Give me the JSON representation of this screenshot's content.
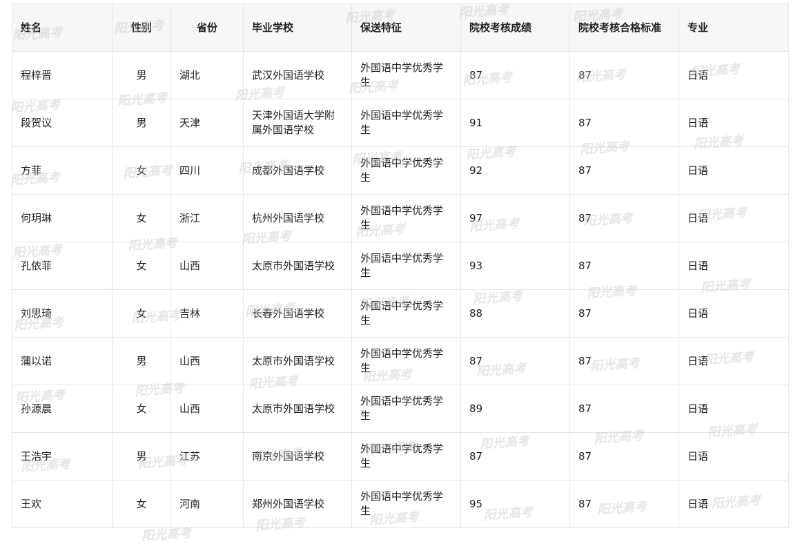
{
  "watermark_text": "阳光高考",
  "table": {
    "headers": [
      "姓名",
      "性别",
      "省份",
      "毕业学校",
      "保送特征",
      "院校考核成绩",
      "院校考核合格标准",
      "专业"
    ],
    "rows": [
      [
        "程梓晋",
        "男",
        "湖北",
        "武汉外国语学校",
        "外国语中学优秀学生",
        "87",
        "87",
        "日语"
      ],
      [
        "段贺议",
        "男",
        "天津",
        "天津外国语大学附属外国语学校",
        "外国语中学优秀学生",
        "91",
        "87",
        "日语"
      ],
      [
        "方菲",
        "女",
        "四川",
        "成都外国语学校",
        "外国语中学优秀学生",
        "92",
        "87",
        "日语"
      ],
      [
        "何玥琳",
        "女",
        "浙江",
        "杭州外国语学校",
        "外国语中学优秀学生",
        "97",
        "87",
        "日语"
      ],
      [
        "孔依菲",
        "女",
        "山西",
        "太原市外国语学校",
        "外国语中学优秀学生",
        "93",
        "87",
        "日语"
      ],
      [
        "刘思琦",
        "女",
        "吉林",
        "长春外国语学校",
        "外国语中学优秀学生",
        "88",
        "87",
        "日语"
      ],
      [
        "蒲以诺",
        "男",
        "山西",
        "太原市外国语学校",
        "外国语中学优秀学生",
        "87",
        "87",
        "日语"
      ],
      [
        "孙源晨",
        "女",
        "山西",
        "太原市外国语学校",
        "外国语中学优秀学生",
        "89",
        "87",
        "日语"
      ],
      [
        "王浩宇",
        "男",
        "江苏",
        "南京外国语学校",
        "外国语中学优秀学生",
        "87",
        "87",
        "日语"
      ],
      [
        "王欢",
        "女",
        "河南",
        "郑州外国语学校",
        "外国语中学优秀学生",
        "95",
        "87",
        "日语"
      ]
    ]
  }
}
